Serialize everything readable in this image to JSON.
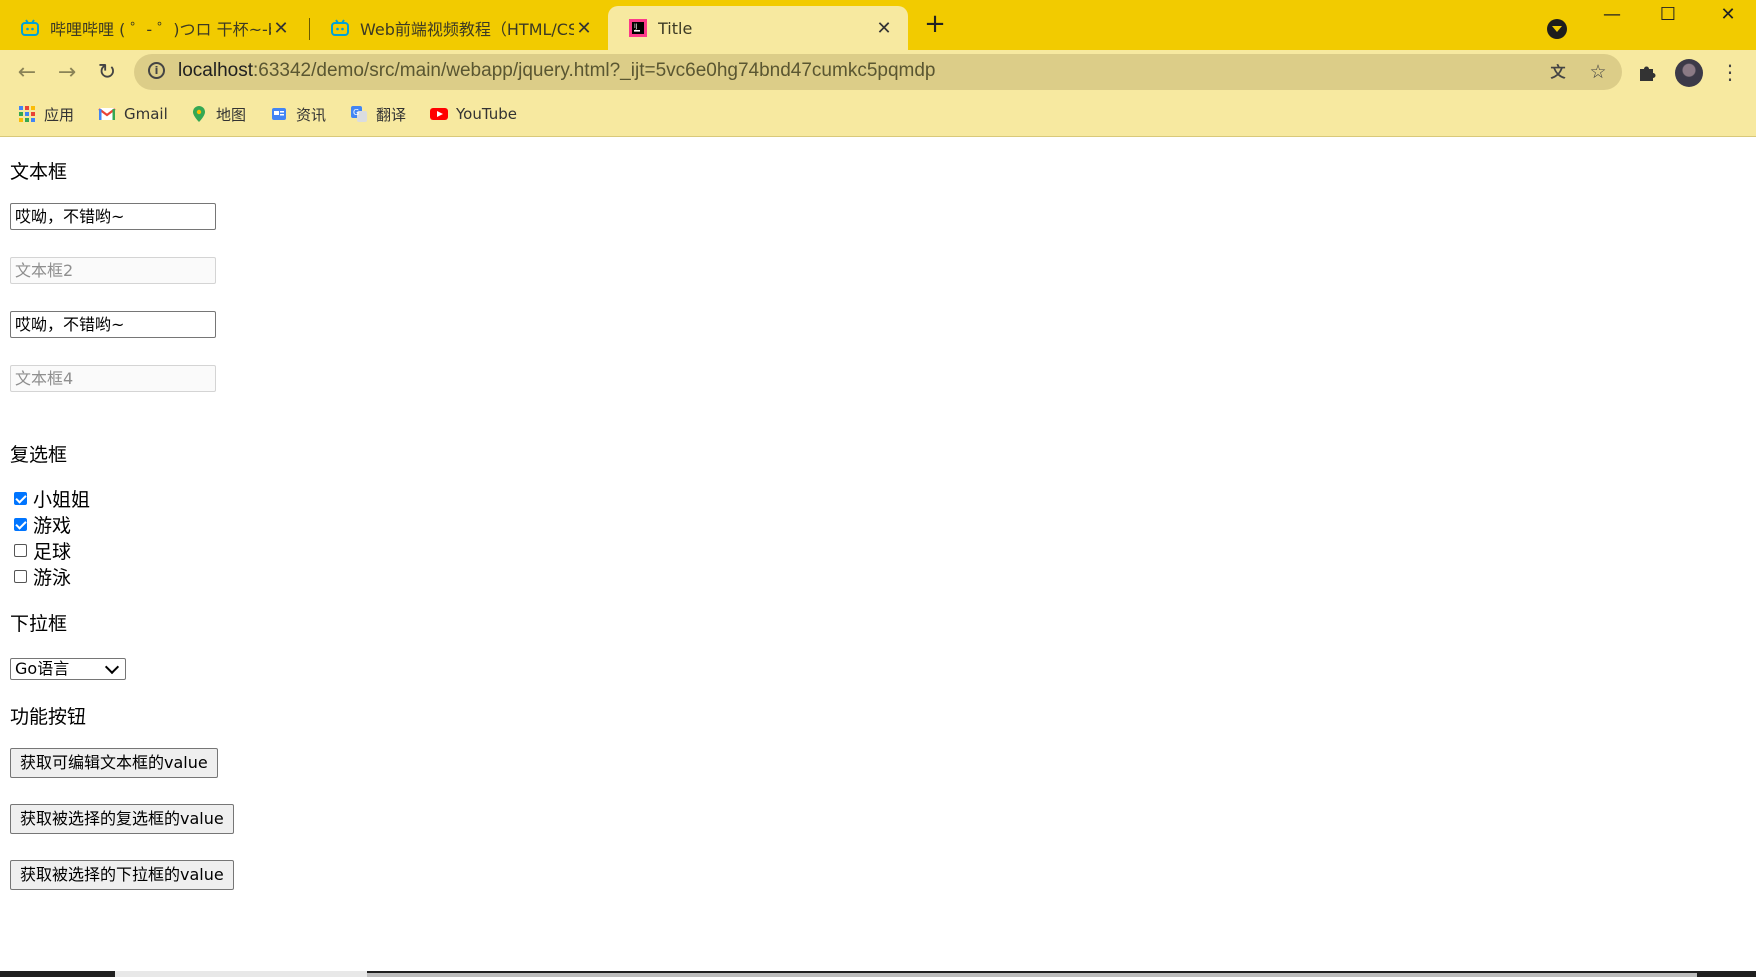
{
  "browser": {
    "tabs": [
      {
        "title": "哔哩哔哩 ( ゜- ゜)つロ 干杯~-bilibili",
        "icon": "bilibili-icon",
        "active": false
      },
      {
        "title": "Web前端视频教程（HTML/CSS/",
        "icon": "bilibili-icon",
        "active": false
      },
      {
        "title": "Title",
        "icon": "jetbrains-icon",
        "active": true
      }
    ],
    "new_tab_label": "+",
    "url_host": "localhost",
    "url_rest": ":63342/demo/src/main/webapp/jquery.html?_ijt=5vc6e0hg74bnd47cumkc5pqmdp",
    "bookmarks": [
      {
        "label": "应用",
        "icon": "apps-grid-icon"
      },
      {
        "label": "Gmail",
        "icon": "gmail-icon"
      },
      {
        "label": "地图",
        "icon": "maps-icon"
      },
      {
        "label": "资讯",
        "icon": "news-icon"
      },
      {
        "label": "翻译",
        "icon": "translate-icon"
      },
      {
        "label": "YouTube",
        "icon": "youtube-icon"
      }
    ],
    "accent_color": "#f2cb00"
  },
  "page": {
    "textbox_section": {
      "title": "文本框",
      "fields": [
        {
          "value": "哎呦，不错哟~",
          "placeholder": "",
          "disabled": false
        },
        {
          "value": "",
          "placeholder": "文本框2",
          "disabled": true
        },
        {
          "value": "哎呦，不错哟~",
          "placeholder": "",
          "disabled": false
        },
        {
          "value": "",
          "placeholder": "文本框4",
          "disabled": true
        }
      ]
    },
    "checkbox_section": {
      "title": "复选框",
      "items": [
        {
          "label": "小姐姐",
          "checked": true
        },
        {
          "label": "游戏",
          "checked": true
        },
        {
          "label": "足球",
          "checked": false
        },
        {
          "label": "游泳",
          "checked": false
        }
      ]
    },
    "select_section": {
      "title": "下拉框",
      "selected": "Go语言"
    },
    "buttons_section": {
      "title": "功能按钮",
      "buttons": [
        "获取可编辑文本框的value",
        "获取被选择的复选框的value",
        "获取被选择的下拉框的value"
      ]
    }
  }
}
